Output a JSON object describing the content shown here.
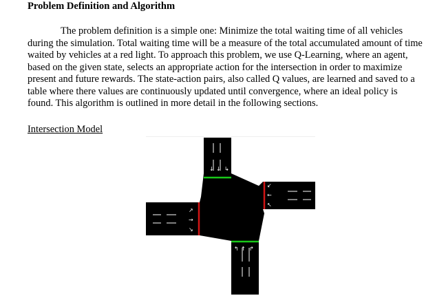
{
  "document": {
    "heading": "Problem Definition and Algorithm",
    "paragraph": "The problem definition is a simple one: Minimize the total waiting time of all vehicles during the simulation. Total waiting time will be a measure of the total accumulated amount of time waited by vehicles at a red light. To approach this problem, we use Q-Learning, where an agent, based on the given state, selects an appropriate action for the intersection in order to maximize present and future rewards. The state-action pairs, also called Q values, are learned and saved to a table where there values are continuously updated until convergence, where an ideal policy is found. This algorithm is outlined in more detail in the following sections.",
    "subheading": "Intersection Model"
  },
  "intersection": {
    "colors": {
      "background": "#ffffff",
      "road": "#000000",
      "lane_marking": "#ffffff",
      "green_signal": "#19c819",
      "red_signal": "#d21414"
    },
    "signals": {
      "north": "green",
      "south": "green",
      "east": "red",
      "west": "red"
    }
  }
}
